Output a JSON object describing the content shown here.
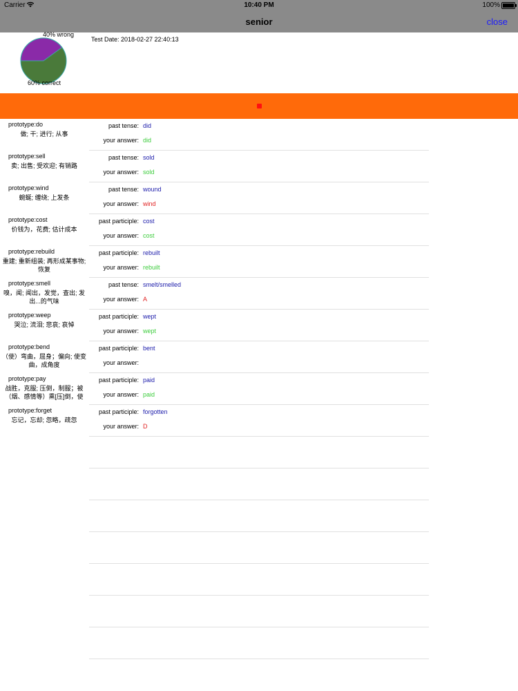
{
  "status": {
    "carrier": "Carrier",
    "time": "10:40 PM",
    "battery": "100%"
  },
  "nav": {
    "title": "senior",
    "close": "close"
  },
  "summary": {
    "wrong_label": "40% wrong",
    "correct_label": "60% correct",
    "test_date": "Test Date: 2018-02-27 22:40:13",
    "wrong_pct": 40,
    "correct_pct": 60,
    "wrong_color": "#8a2aa8",
    "correct_color": "#4a7a3a"
  },
  "colors": {
    "accent_bar": "#ff6a0a",
    "indicator": "#ff1010"
  },
  "labels": {
    "your_answer": "your answer:"
  },
  "items": [
    {
      "prototype": "prototype:do",
      "meaning": "做; 干; 进行; 从事",
      "form": "past tense:",
      "expected": "did",
      "answer": "did",
      "correct": true
    },
    {
      "prototype": "prototype:sell",
      "meaning": "卖; 出售; 受欢迎; 有销路",
      "form": "past tense:",
      "expected": "sold",
      "answer": "sold",
      "correct": true
    },
    {
      "prototype": "prototype:wind",
      "meaning": "蜿蜒; 缠绕; 上发条",
      "form": "past tense:",
      "expected": "wound",
      "answer": "wind",
      "correct": false
    },
    {
      "prototype": "prototype:cost",
      "meaning": "价钱为，花费; 估计成本",
      "form": "past participle:",
      "expected": "cost",
      "answer": "cost",
      "correct": true
    },
    {
      "prototype": "prototype:rebuild",
      "meaning": "重建; 重新组装; 再形成某事物; 恢复",
      "form": "past participle:",
      "expected": "rebuilt",
      "answer": "rebuilt",
      "correct": true
    },
    {
      "prototype": "prototype:smell",
      "meaning": "嗅，闻; 闻出，发觉，查出; 发出...的气味",
      "form": "past tense:",
      "expected": "smelt/smelled",
      "answer": "A",
      "correct": false
    },
    {
      "prototype": "prototype:weep",
      "meaning": "哭泣; 流泪; 悲哀; 哀悼",
      "form": "past participle:",
      "expected": "wept",
      "answer": "wept",
      "correct": true
    },
    {
      "prototype": "prototype:bend",
      "meaning": "（使）弯曲，屈身；偏向; 使变曲，成角度",
      "form": "past participle:",
      "expected": "bent",
      "answer": "",
      "correct": false
    },
    {
      "prototype": "prototype:pay",
      "meaning": "战胜，克服; 压倒，制服；被（烟、感情等）熏[压]倒，使",
      "form": "past participle:",
      "expected": "paid",
      "answer": "paid",
      "correct": true
    },
    {
      "prototype": "prototype:forget",
      "meaning": "忘记，忘却; 忽略，疏忽",
      "form": "past participle:",
      "expected": "forgotten",
      "answer": "D",
      "correct": false
    }
  ]
}
